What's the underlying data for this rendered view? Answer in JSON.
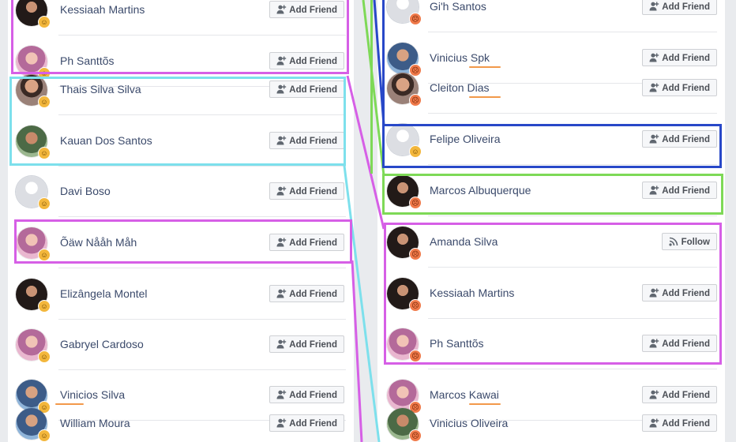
{
  "left_column": {
    "rows": [
      {
        "name": "Kessiaah Martins",
        "button": "Add Friend"
      },
      {
        "name": "Ph Santtõs",
        "button": "Add Friend"
      },
      {
        "name": "Thais Silva Silva",
        "button": "Add Friend"
      },
      {
        "name": "Kauan Dos Santos",
        "button": "Add Friend"
      },
      {
        "name": "Davi Boso",
        "button": "Add Friend"
      },
      {
        "name": "Õäw Nååh Måh",
        "button": "Add Friend"
      },
      {
        "name": "Elizângela Montel",
        "button": "Add Friend"
      },
      {
        "name": "Gabryel Cardoso",
        "button": "Add Friend"
      },
      {
        "name": "Vinicios Silva",
        "button": "Add Friend"
      },
      {
        "name": "William Moura",
        "button": "Add Friend"
      }
    ]
  },
  "right_column": {
    "rows": [
      {
        "name": "Gi'h Santos",
        "button": "Add Friend"
      },
      {
        "name": "Vinicius Spk",
        "button": "Add Friend"
      },
      {
        "name": "Cleiton Dias",
        "button": "Add Friend"
      },
      {
        "name": "Felipe Oliveira",
        "button": "Add Friend"
      },
      {
        "name": "Marcos Albuquerque",
        "button": "Add Friend"
      },
      {
        "name": "Amanda Silva",
        "button": "Follow"
      },
      {
        "name": "Kessiaah Martins",
        "button": "Add Friend"
      },
      {
        "name": "Ph Santtõs",
        "button": "Add Friend"
      },
      {
        "name": "Marcos Kawai",
        "button": "Add Friend"
      },
      {
        "name": "Vinicius Oliveira",
        "button": "Add Friend"
      }
    ]
  },
  "icons": {
    "add_friend": "person-plus-icon",
    "follow": "rss-icon",
    "reaction_badge": "reaction-emoji-icon"
  },
  "highlight_colors": {
    "magenta": "#d65fe6",
    "cyan": "#7de0ec",
    "blue": "#2848c8",
    "green": "#7ed957",
    "name_underline": "#f2994a"
  }
}
